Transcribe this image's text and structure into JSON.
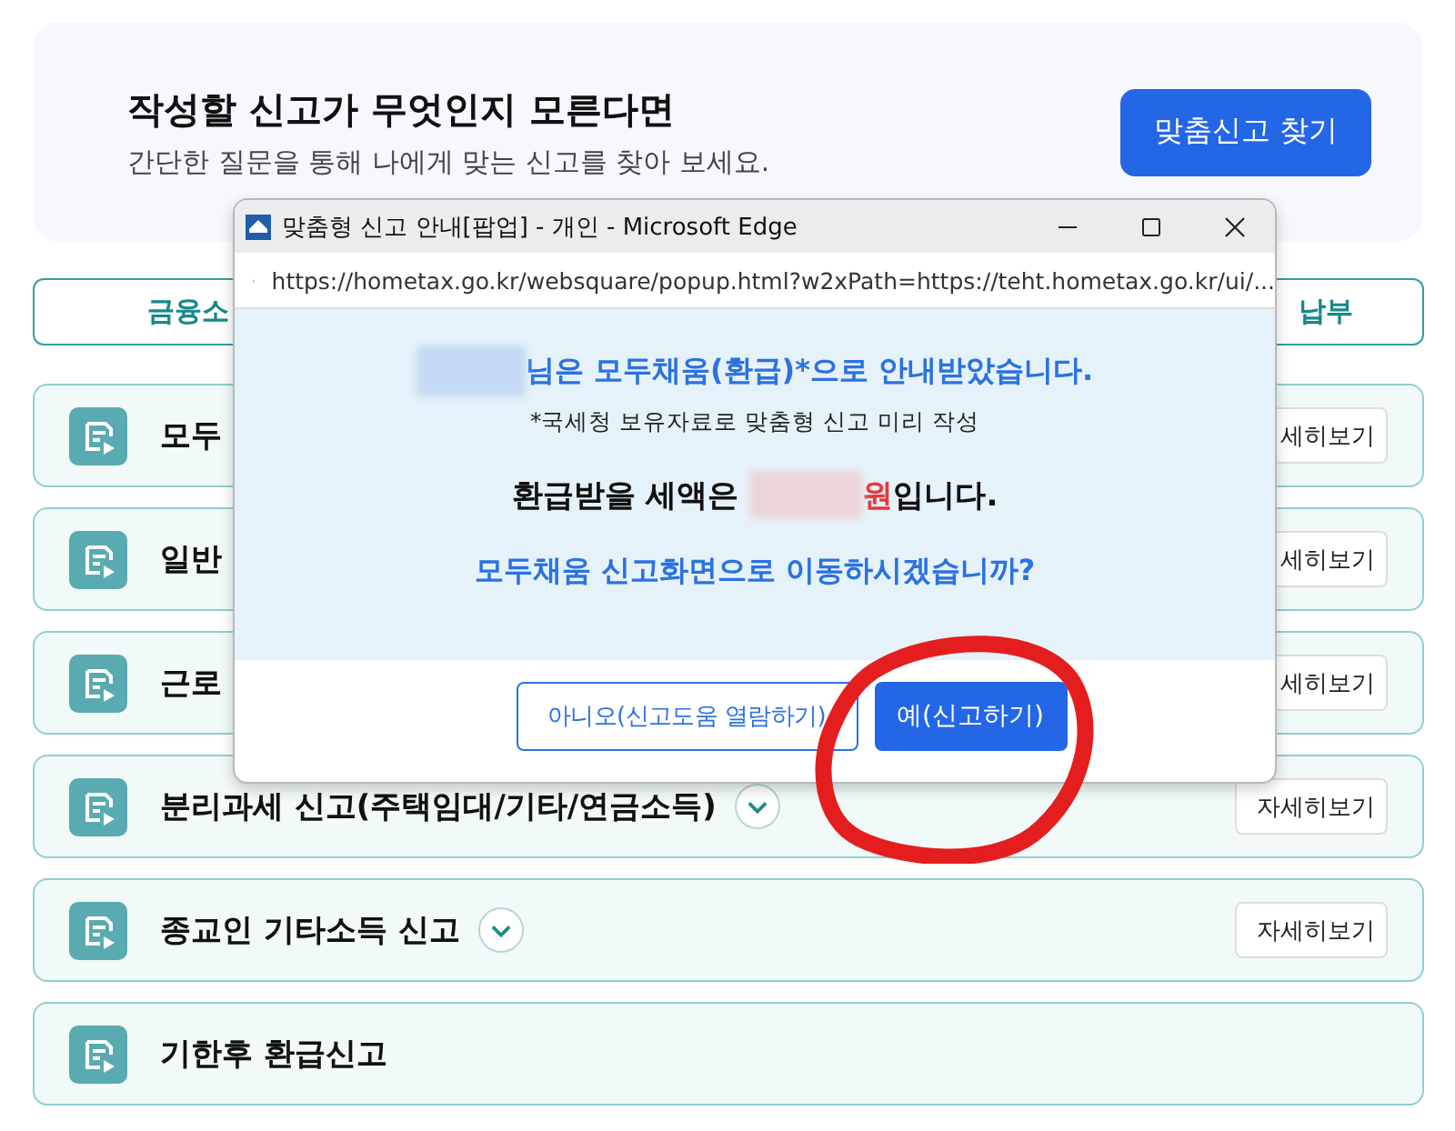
{
  "hero": {
    "title": "작성할 신고가 무엇인지 모른다면",
    "subtitle": "간단한 질문을 통해 나에게 맞는 신고를 찾아 보세요.",
    "button": "맞춤신고 찾기"
  },
  "filter_buttons": [
    {
      "label": "금융소"
    },
    {
      "label": "납부"
    }
  ],
  "rows": [
    {
      "title": "모두",
      "detail_button": "세히보기"
    },
    {
      "title": "일반",
      "detail_button": "세히보기"
    },
    {
      "title": "근로",
      "detail_button": "세히보기"
    },
    {
      "title": "분리과세 신고(주택임대/기타/연금소득)",
      "expandable": true,
      "detail_button": "자세히보기"
    },
    {
      "title": "종교인 기타소득 신고",
      "expandable": true,
      "detail_button": "자세히보기"
    },
    {
      "title": "기한후 환급신고",
      "expandable": false
    }
  ],
  "popup": {
    "window_title": "맞춤형 신고 안내[팝업] - 개인 - Microsoft Edge",
    "url": "https://hometax.go.kr/websquare/popup.html?w2xPath=https://teht.hometax.go.kr/ui/...",
    "message": "님은 모두채움(환급)*으로 안내받았습니다.",
    "note": "*국세청 보유자료로 맞춤형 신고 미리 작성",
    "refund_prefix": "환급받을 세액은",
    "refund_unit": "원",
    "refund_suffix": "입니다.",
    "question": "모두채움 신고화면으로 이동하시겠습니까?",
    "buttons": [
      {
        "label": "아니오(신고도움 열람하기)",
        "kind": "secondary"
      },
      {
        "label": "예(신고하기)",
        "kind": "primary"
      }
    ]
  }
}
